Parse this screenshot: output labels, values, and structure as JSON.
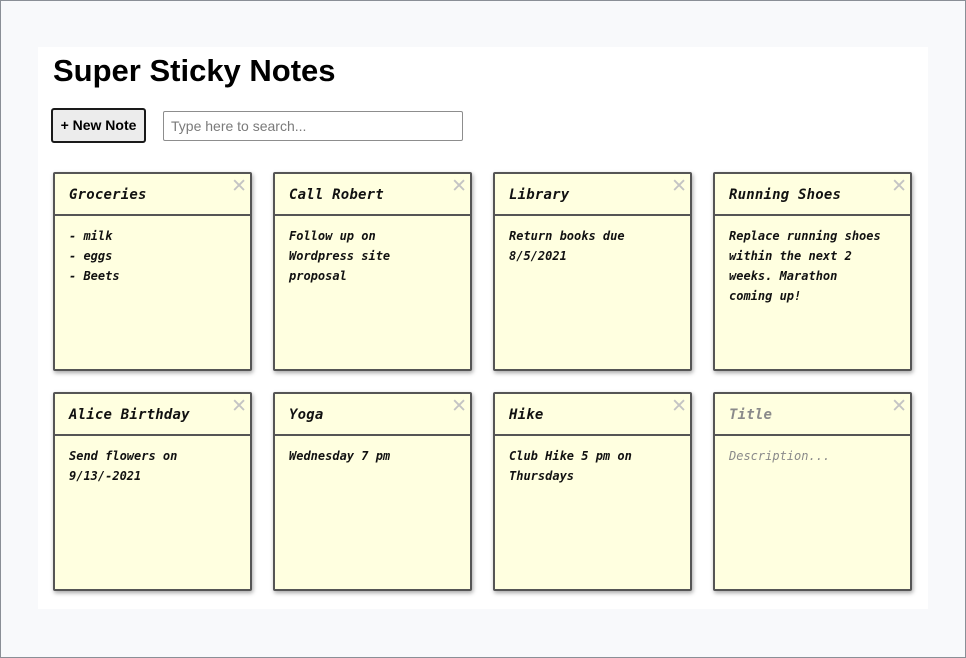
{
  "app": {
    "title": "Super Sticky Notes"
  },
  "toolbar": {
    "new_note_label": "+ New Note",
    "search_placeholder": "Type here to search...",
    "search_value": ""
  },
  "notes": [
    {
      "title": "Groceries",
      "description": "- milk\n- eggs\n- Beets",
      "close_icon": "close-icon"
    },
    {
      "title": "Call Robert",
      "description": "Follow up on\nWordpress site\nproposal",
      "close_icon": "close-icon"
    },
    {
      "title": "Library",
      "description": "Return books due\n8/5/2021",
      "close_icon": "close-icon"
    },
    {
      "title": "Running Shoes",
      "description": "Replace running shoes\nwithin the next 2\nweeks. Marathon\ncoming up!",
      "close_icon": "close-icon"
    },
    {
      "title": "Alice Birthday",
      "description": "Send flowers on\n9/13/-2021",
      "close_icon": "close-icon"
    },
    {
      "title": "Yoga",
      "description": "Wednesday 7 pm",
      "close_icon": "close-icon"
    },
    {
      "title": "Hike",
      "description": "Club Hike 5 pm on\nThursdays",
      "close_icon": "close-icon"
    },
    {
      "title": "",
      "description": "",
      "title_placeholder": "Title",
      "description_placeholder": "Description...",
      "close_icon": "close-icon"
    }
  ],
  "colors": {
    "note_background": "#ffffe0",
    "note_border": "#555555",
    "close_icon": "#c4c4c4",
    "placeholder_text": "#8a8a8a"
  }
}
